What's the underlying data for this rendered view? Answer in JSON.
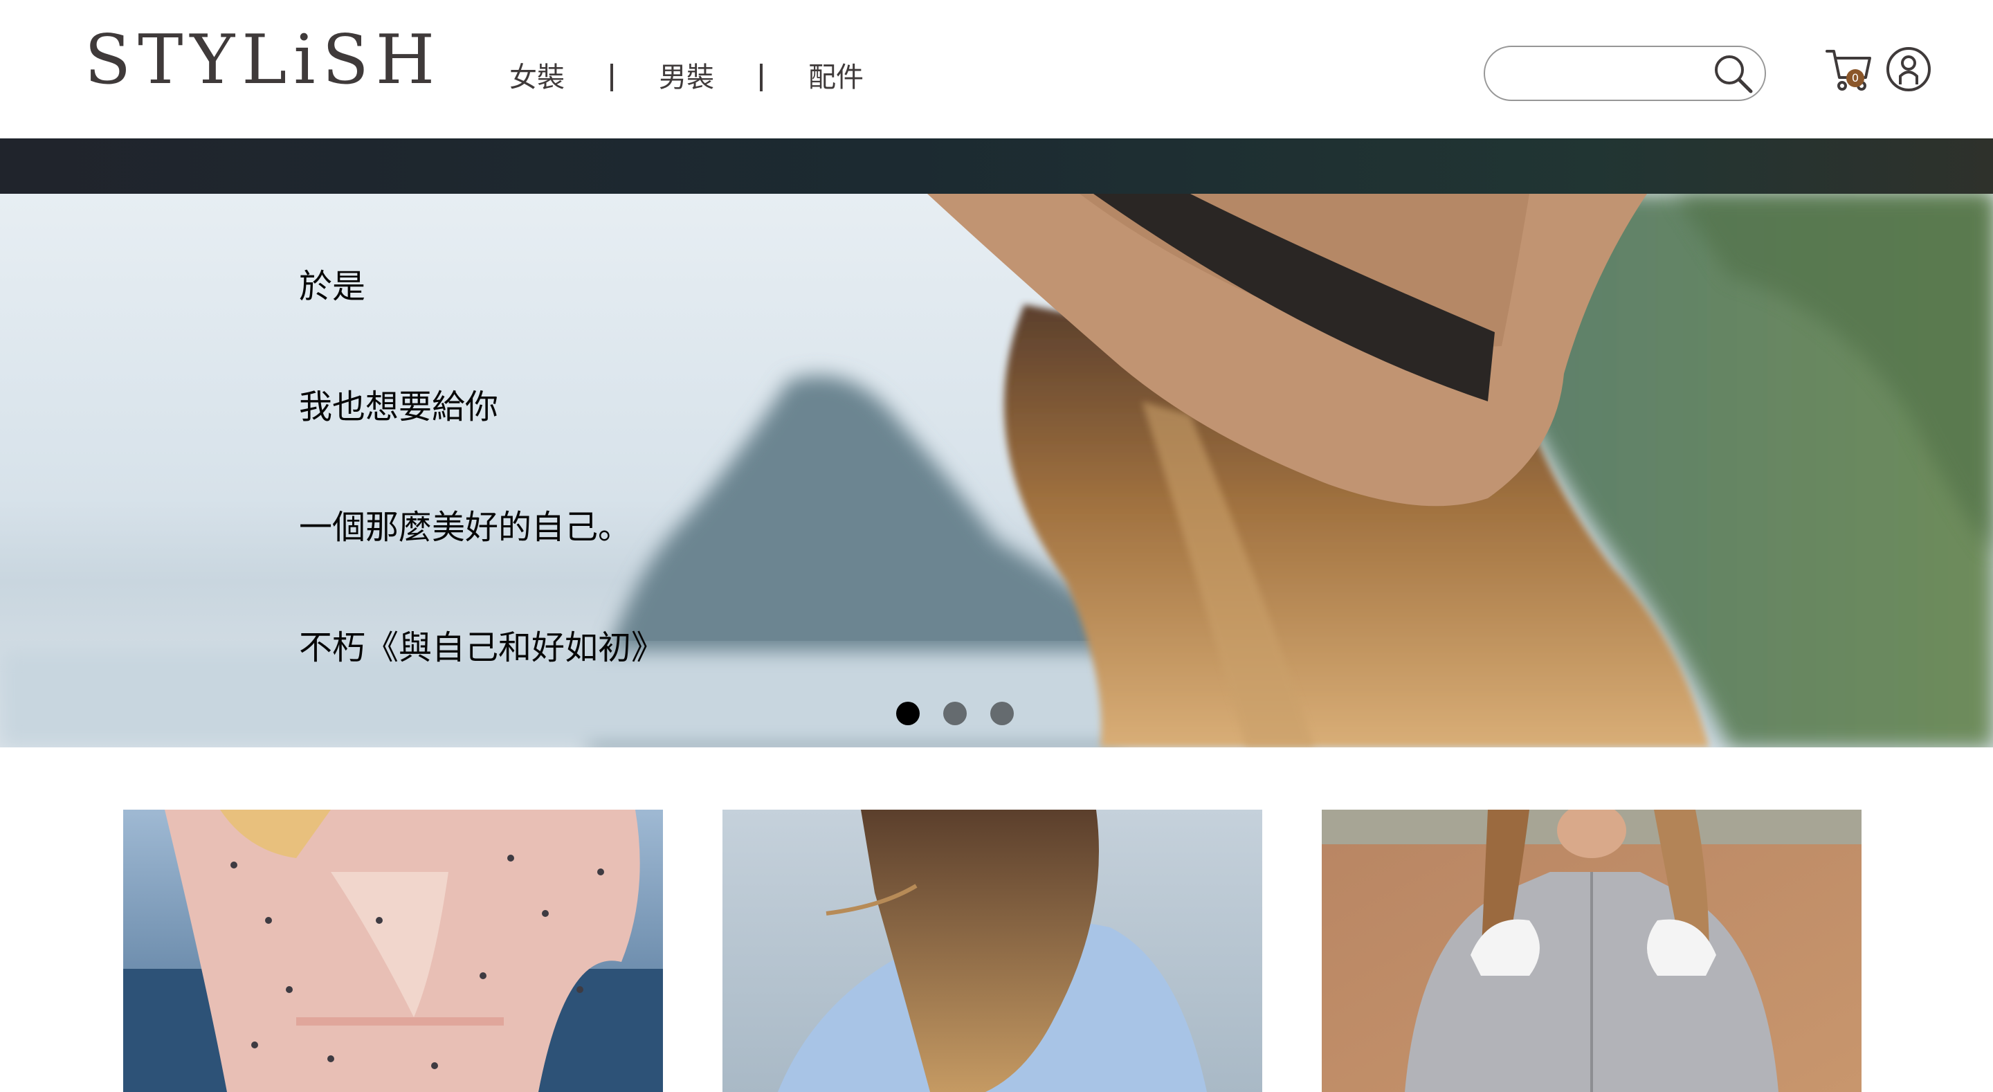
{
  "header": {
    "logo_text": "STYLiSH",
    "nav": [
      {
        "label": "女裝"
      },
      {
        "label": "男裝"
      },
      {
        "label": "配件"
      }
    ],
    "search": {
      "value": "",
      "placeholder": ""
    },
    "cart_count": "0",
    "icons": {
      "search": "search-icon",
      "cart": "cart-icon",
      "member": "member-icon"
    }
  },
  "hero": {
    "lines": [
      "於是",
      "我也想要給你",
      "一個那麼美好的自己。",
      "不朽《與自己和好如初》"
    ],
    "dots_count": 3,
    "active_dot": 1
  },
  "colors": {
    "text": "#3f3a3a",
    "band_dark": "#1c2a31",
    "cart_badge": "#8b572a"
  }
}
